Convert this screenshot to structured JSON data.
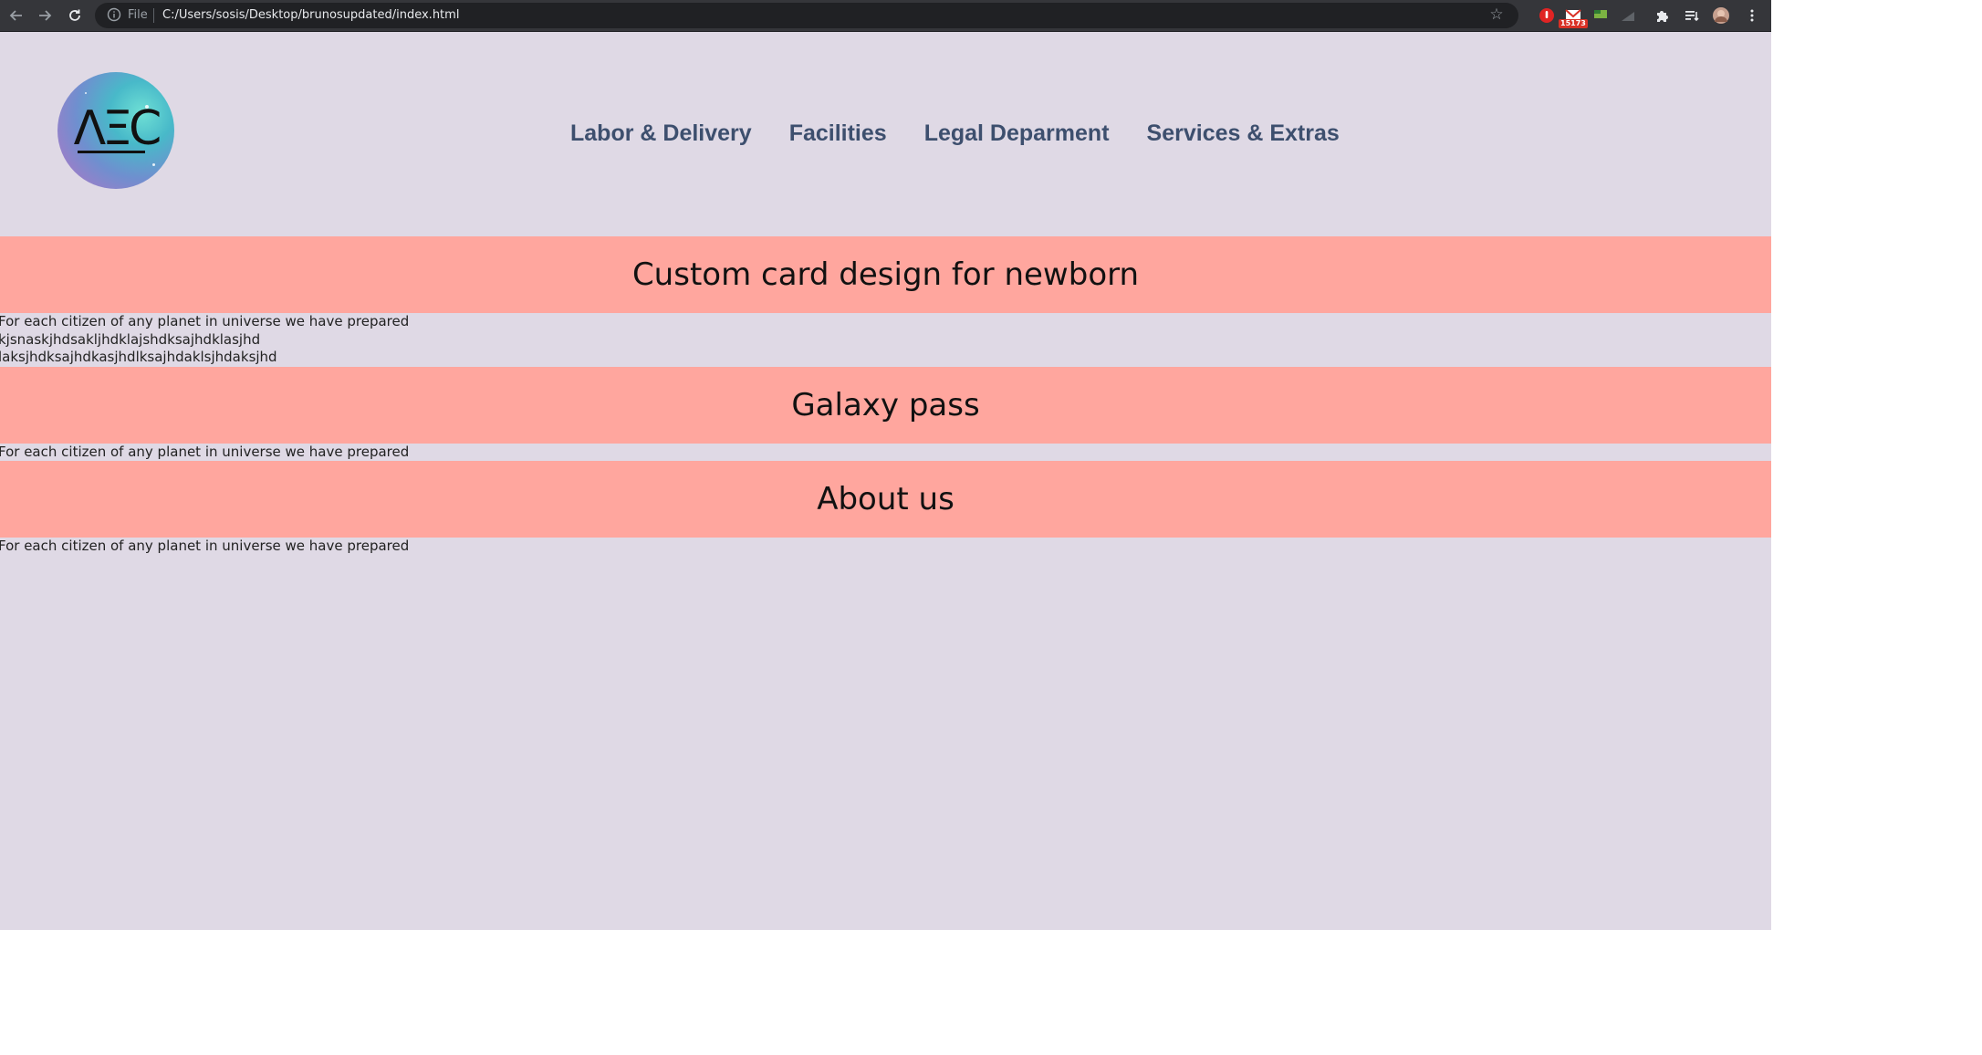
{
  "browser": {
    "nav_icons": {
      "back": "arrow-left-icon",
      "forward": "arrow-right-icon",
      "reload": "reload-icon"
    },
    "address_bar": {
      "scheme_label": "File",
      "url": "C:/Users/sosis/Desktop/brunosupdated/index.html"
    },
    "extensions": {
      "mail_badge": "15173"
    }
  },
  "header": {
    "logo_text": "ΛΞC",
    "nav": [
      {
        "label": "Labor & Delivery"
      },
      {
        "label": "Facilities"
      },
      {
        "label": "Legal Deparment"
      },
      {
        "label": "Services & Extras"
      }
    ]
  },
  "sections": [
    {
      "title": "Custom card design for newborn",
      "paragraphs": [
        "For each citizen of any planet in universe we have prepared",
        "kjsnaskjhdsakljhdklajshdksajhdklasjhd",
        "laksjhdksajhdkasjhdlksajhdaklsjhdaksjhd"
      ]
    },
    {
      "title": "Galaxy pass",
      "paragraphs": [
        "For each citizen of any planet in universe we have prepared"
      ]
    },
    {
      "title": "About us",
      "paragraphs": [
        "For each citizen of any planet in universe we have prepared"
      ]
    }
  ],
  "colors": {
    "page_background": "#dfd9e5",
    "band_background": "#ffa69e",
    "nav_text": "#3d4f6e",
    "toolbar": "#35363a"
  }
}
